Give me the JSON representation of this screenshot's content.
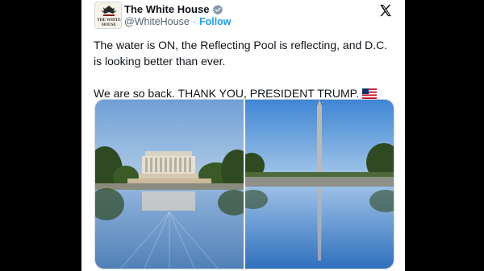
{
  "tweet": {
    "author_name": "The White House",
    "author_handle": "@WhiteHouse",
    "separator": "·",
    "follow_label": "Follow",
    "avatar_text_1": "THE WHITE",
    "avatar_text_2": "HOUSE",
    "paragraph_1": "The water is ON, the Reflecting Pool is reflecting, and D.C. is looking better than ever.",
    "paragraph_2": "We are so back. THANK YOU, PRESIDENT TRUMP.",
    "flag_icon": "us-flag-emoji",
    "verified_icon": "verified-badge-icon",
    "platform_icon": "x-logo-icon"
  },
  "media": {
    "photos": [
      {
        "subject": "lincoln-memorial-reflection"
      },
      {
        "subject": "washington-monument-reflection"
      }
    ]
  },
  "colors": {
    "link": "#1d9bf0",
    "text": "#0f1419",
    "secondary_text": "#536471"
  }
}
